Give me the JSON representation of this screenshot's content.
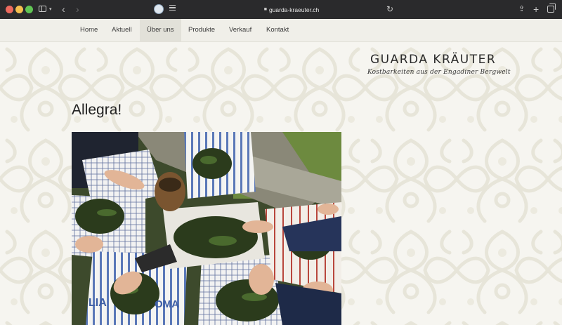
{
  "browser": {
    "url": "guarda-kraeuter.ch",
    "lock_glyph": "🔒"
  },
  "nav": {
    "items": [
      {
        "label": "Home"
      },
      {
        "label": "Aktuell"
      },
      {
        "label": "Über uns",
        "active": true
      },
      {
        "label": "Produkte"
      },
      {
        "label": "Verkauf"
      },
      {
        "label": "Kontakt"
      }
    ]
  },
  "logo": {
    "title": "GUARDA KRÄUTER",
    "subtitle": "Kostbarkeiten aus der Engadiner Bergwelt"
  },
  "main": {
    "heading": "Allegra!",
    "photo_text_1": "LIA",
    "photo_text_2": "OMA"
  },
  "colors": {
    "background": "#f6f5f0",
    "nav_bg": "#f0efe9",
    "nav_active": "#e2e1d9",
    "pattern": "#e9e7dc"
  }
}
